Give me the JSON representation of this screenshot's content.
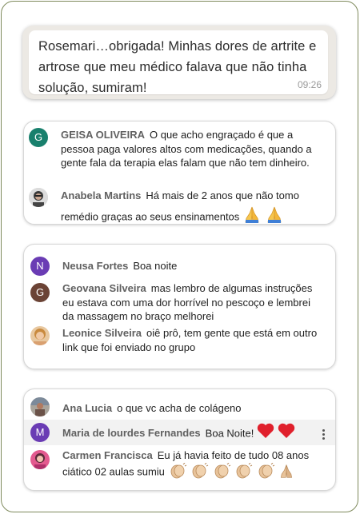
{
  "whatsapp": {
    "message": "Rosemari…obrigada! Minhas dores de artrite e artrose que meu médico falava que não tinha solução, sumiram!",
    "time": "09:26"
  },
  "card1": {
    "comments": [
      {
        "initial": "G",
        "author": "GEISA OLIVEIRA",
        "text": "O que acho engraçado é que a pessoa paga valores altos com medicações, quando a gente fala da terapia elas falam que não tem dinheiro."
      },
      {
        "author": "Anabela Martins",
        "text": "Há mais de 2 anos que não tomo remédio graças ao seus ensinamentos"
      }
    ]
  },
  "card2": {
    "comments": [
      {
        "initial": "N",
        "author": "Neusa Fortes",
        "text": "Boa noite"
      },
      {
        "initial": "G",
        "author": "Geovana Silveira",
        "text": "mas lembro de algumas instruções eu estava com uma dor horrível no pescoço e lembrei da massagem no braço melhorei"
      },
      {
        "author": "Leonice Silveira",
        "text": "oiê prô, tem gente que está em outro link que foi enviado no grupo"
      }
    ]
  },
  "card3": {
    "comments": [
      {
        "author": "Ana Lucia",
        "text": "o que vc acha de colágeno"
      },
      {
        "initial": "M",
        "author": "Maria de lourdes Fernandes",
        "text": "Boa Noite!"
      },
      {
        "author": "Carmen Francisca",
        "text": "Eu já havia feito de tudo 08 anos ciático 02 aulas sumiu"
      }
    ]
  },
  "colors": {
    "avatar_green": "#19806d",
    "avatar_purple": "#6a3cb4",
    "avatar_brown": "#6b4335",
    "heart": "#e0202c",
    "frame": "#7e8a5c"
  },
  "icons": [
    "praying-hands-icon",
    "red-heart-icon",
    "clapping-hands-icon",
    "more-options-icon"
  ]
}
